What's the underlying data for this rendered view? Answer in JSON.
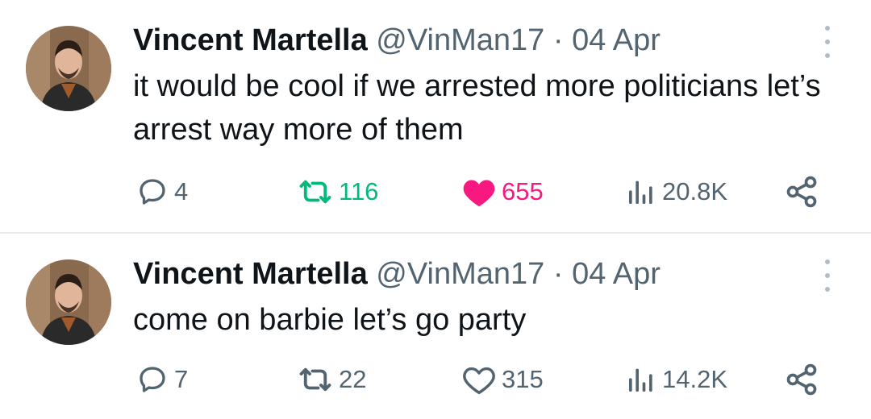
{
  "tweets": [
    {
      "author": "Vincent Martella",
      "handle": "@VinMan17",
      "date": "· 04 Apr",
      "text": "it would be cool if we arrested more politicians let’s arrest way more of them",
      "replies": "4",
      "retweets": "116",
      "likes": "655",
      "views": "20.8K",
      "retweeted": true,
      "liked": true
    },
    {
      "author": "Vincent Martella",
      "handle": "@VinMan17",
      "date": "· 04 Apr",
      "text": "come on barbie let’s go party",
      "replies": "7",
      "retweets": "22",
      "likes": "315",
      "views": "14.2K",
      "retweeted": false,
      "liked": false
    }
  ],
  "colors": {
    "retweet_active": "#00ba7c",
    "like_active": "#f91880",
    "muted": "#536471"
  },
  "icons": [
    "reply-icon",
    "retweet-icon",
    "heart-icon",
    "views-icon",
    "share-icon",
    "more-icon"
  ]
}
